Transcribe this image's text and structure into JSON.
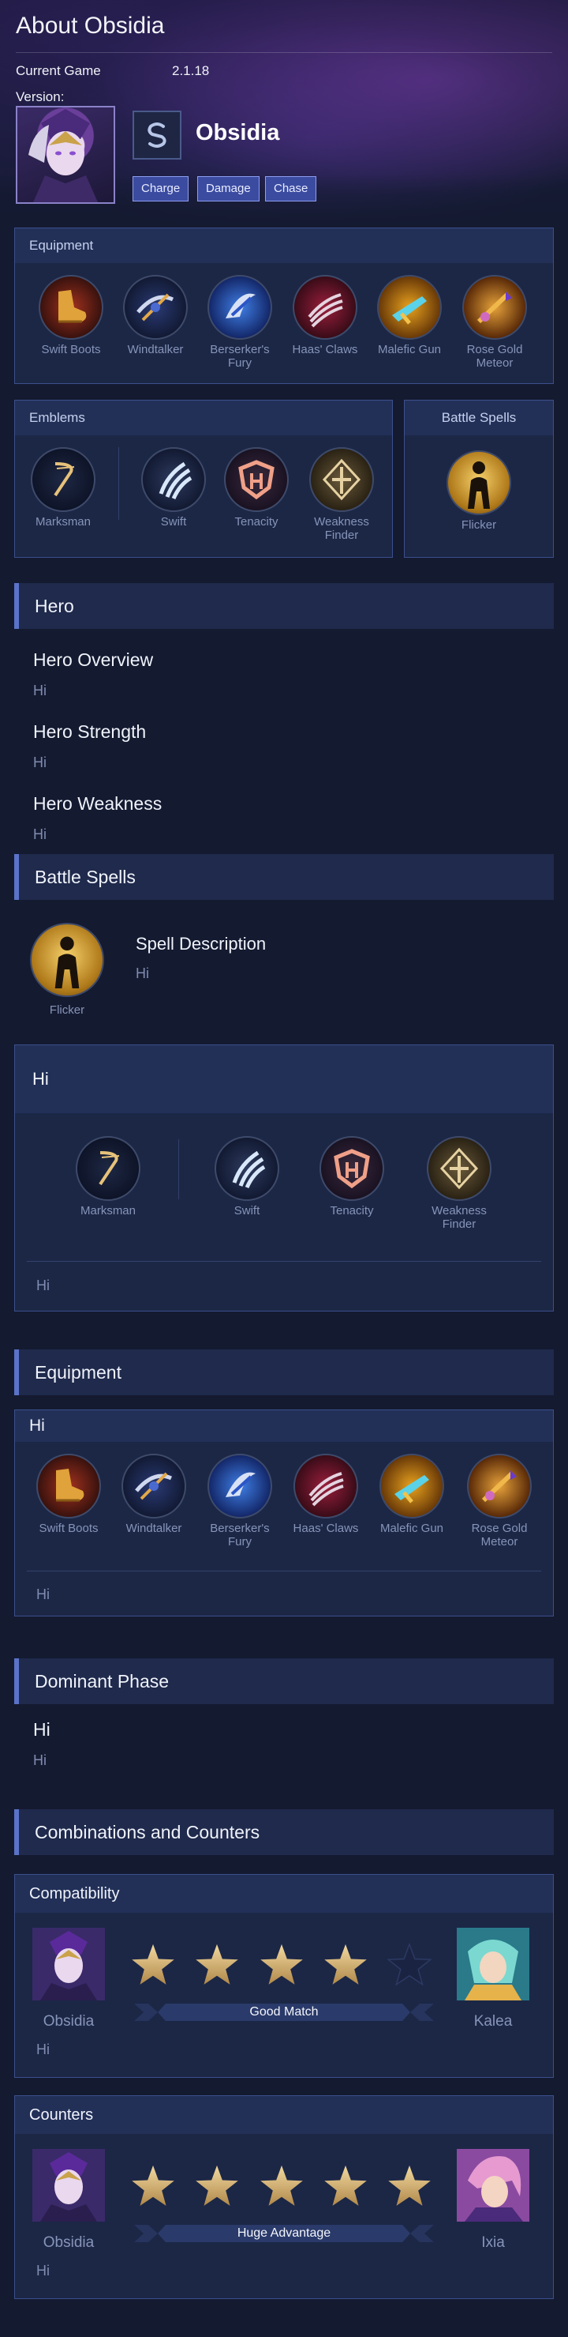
{
  "header": {
    "title": "About Obsidia",
    "current_game_label": "Current Game",
    "version_label": "Version:",
    "version_value": "2.1.18",
    "hero_name": "Obsidia",
    "tags": [
      "Charge",
      "Damage",
      "Chase"
    ]
  },
  "equipment_panel": {
    "title": "Equipment",
    "items": [
      "Swift Boots",
      "Windtalker",
      "Berserker's Fury",
      "Haas' Claws",
      "Malefic Gun",
      "Rose Gold Meteor"
    ]
  },
  "emblems_panel": {
    "title": "Emblems",
    "items": [
      "Marksman",
      "Swift",
      "Tenacity",
      "Weakness Finder"
    ]
  },
  "spells_panel": {
    "title": "Battle Spells",
    "spell": "Flicker"
  },
  "hero_section": {
    "title": "Hero",
    "overview_title": "Hero Overview",
    "overview_text": "Hi",
    "strength_title": "Hero Strength",
    "strength_text": "Hi",
    "weakness_title": "Hero Weakness",
    "weakness_text": "Hi"
  },
  "battle_spells_section": {
    "title": "Battle Spells",
    "spell": "Flicker",
    "desc_title": "Spell Description",
    "desc_text": "Hi"
  },
  "emblem_detail": {
    "title": "Hi",
    "items": [
      "Marksman",
      "Swift",
      "Tenacity",
      "Weakness Finder"
    ],
    "footer": "Hi"
  },
  "equipment_section": {
    "title": "Equipment",
    "panel_title": "Hi",
    "items": [
      "Swift Boots",
      "Windtalker",
      "Berserker's Fury",
      "Haas' Claws",
      "Malefic Gun",
      "Rose Gold Meteor"
    ],
    "footer": "Hi"
  },
  "dominant_phase": {
    "title": "Dominant Phase",
    "heading": "Hi",
    "text": "Hi"
  },
  "combos": {
    "title": "Combinations and Counters",
    "compatibility": {
      "title": "Compatibility",
      "hero": "Obsidia",
      "partner": "Kalea",
      "label": "Good Match",
      "rating": 4,
      "max_rating": 5,
      "note": "Hi"
    },
    "counters": {
      "title": "Counters",
      "hero": "Obsidia",
      "partner": "Ixia",
      "label": "Huge Advantage",
      "rating": 5,
      "max_rating": 5,
      "note": "Hi"
    }
  }
}
